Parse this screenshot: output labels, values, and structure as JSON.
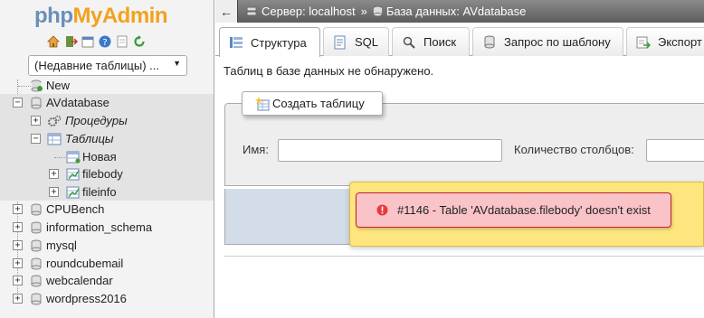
{
  "logo": {
    "part1": "php",
    "part2": "MyAdmin"
  },
  "nav": {
    "quick_icons": [
      "home-icon",
      "logout-icon",
      "sql-query-icon",
      "help-icon",
      "docs-icon",
      "reload-icon"
    ],
    "recent_select": "(Недавние таблицы) ...",
    "tree": {
      "new_label": "New",
      "current_db": "AVdatabase",
      "procedures_label": "Процедуры",
      "tables_label": "Таблицы",
      "new_table_label": "Новая",
      "tables": [
        "filebody",
        "fileinfo"
      ],
      "other_dbs": [
        "CPUBench",
        "information_schema",
        "mysql",
        "roundcubemail",
        "webcalendar",
        "wordpress2016"
      ]
    }
  },
  "breadcrumb": {
    "server": "Сервер: localhost",
    "separator": "»",
    "database": "База данных: AVdatabase"
  },
  "tabs": [
    {
      "label": "Структура",
      "icon": "structure-icon",
      "active": true
    },
    {
      "label": "SQL",
      "icon": "sql-icon",
      "active": false
    },
    {
      "label": "Поиск",
      "icon": "search-icon",
      "active": false
    },
    {
      "label": "Запрос по шаблону",
      "icon": "query-icon",
      "active": false
    },
    {
      "label": "Экспорт",
      "icon": "export-icon",
      "active": false
    }
  ],
  "main": {
    "no_tables_msg": "Таблиц в базе данных не обнаружено.",
    "create_table_label": "Создать таблицу",
    "name_label": "Имя:",
    "name_value": "",
    "columns_label": "Количество столбцов:",
    "columns_value": ""
  },
  "error": {
    "message": "#1146 - Table 'AVdatabase.filebody' doesn't exist"
  },
  "colors": {
    "logo_php": "#6b8fb8",
    "logo_myadmin": "#f2a21d",
    "error_bg": "#f9c3c7",
    "error_border": "#c0232c",
    "overlay_bg": "#ffe57d",
    "footer_bar": "#d3dde9"
  }
}
